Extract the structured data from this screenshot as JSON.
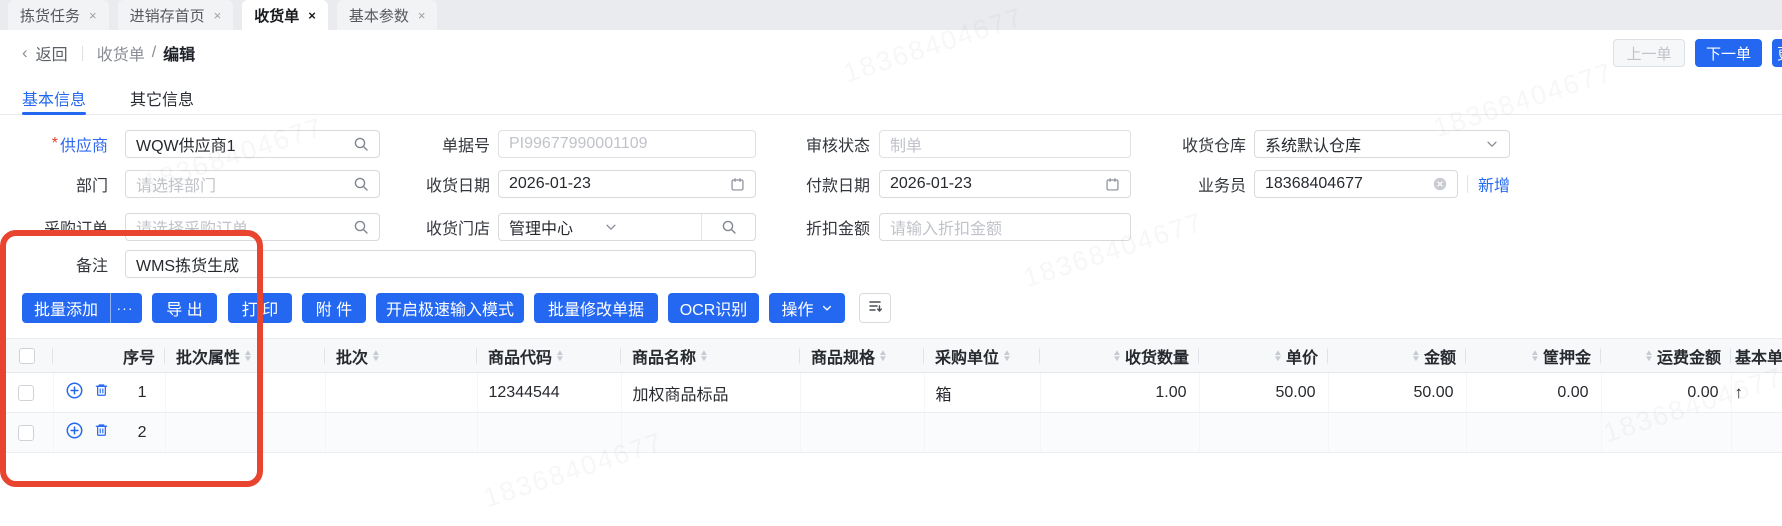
{
  "window_tabs": [
    {
      "label": "拣货任务",
      "close": "×",
      "active": false
    },
    {
      "label": "进销存首页",
      "close": "×",
      "active": false
    },
    {
      "label": "收货单",
      "close": "×",
      "active": true
    },
    {
      "label": "基本参数",
      "close": "×",
      "active": false
    }
  ],
  "breadcrumb": {
    "back": "返回",
    "section": "收货单",
    "separator": "/",
    "current": "编辑"
  },
  "top_actions": {
    "prev": "上一单",
    "next": "下一单",
    "more_partial": "更多"
  },
  "sub_tabs": {
    "basic": "基本信息",
    "other": "其它信息"
  },
  "form": {
    "supplier": {
      "label": "供应商",
      "required": "*",
      "value": "WQW供应商1"
    },
    "doc_no": {
      "label": "单据号",
      "value": "PI99677990001109"
    },
    "audit_status": {
      "label": "审核状态",
      "value": "制单"
    },
    "warehouse": {
      "label": "收货仓库",
      "value": "系统默认仓库"
    },
    "department": {
      "label": "部门",
      "placeholder": "请选择部门"
    },
    "receive_date": {
      "label": "收货日期",
      "value": "2026-01-23"
    },
    "pay_date": {
      "label": "付款日期",
      "value": "2026-01-23"
    },
    "salesman": {
      "label": "业务员",
      "value": "18368404677",
      "action": "新增"
    },
    "purchase_order": {
      "label": "采购订单",
      "placeholder": "请选择采购订单"
    },
    "receive_store": {
      "label": "收货门店",
      "value": "管理中心"
    },
    "discount": {
      "label": "折扣金额",
      "placeholder": "请输入折扣金额"
    },
    "remark": {
      "label": "备注",
      "value": "WMS拣货生成"
    }
  },
  "toolbar": {
    "batch_add": "批量添加",
    "batch_add_more": "···",
    "export": "导 出",
    "print": "打 印",
    "attachment": "附 件",
    "speed_input": "开启极速输入模式",
    "batch_edit": "批量修改单据",
    "ocr": "OCR识别",
    "operate": "操作"
  },
  "table": {
    "columns": [
      "",
      "序号",
      "批次属性",
      "批次",
      "商品代码",
      "商品名称",
      "商品规格",
      "采购单位",
      "收货数量",
      "单价",
      "金额",
      "筐押金",
      "运费金额",
      "基本单位"
    ],
    "rows": [
      {
        "seq": "1",
        "batch_attr": "",
        "batch": "",
        "code": "12344544",
        "name": "加权商品标品",
        "spec": "",
        "unit": "箱",
        "qty": "1.00",
        "price": "50.00",
        "amount": "50.00",
        "basket_deposit": "0.00",
        "freight": "0.00",
        "base_unit_marker": "↑"
      },
      {
        "seq": "2",
        "batch_attr": "",
        "batch": "",
        "code": "",
        "name": "",
        "spec": "",
        "unit": "",
        "qty": "",
        "price": "",
        "amount": "",
        "basket_deposit": "",
        "freight": "",
        "base_unit_marker": ""
      }
    ]
  },
  "colors": {
    "accent": "#2468f2",
    "annotation": "#e8442f"
  },
  "watermark": {
    "text": "18368404677"
  }
}
